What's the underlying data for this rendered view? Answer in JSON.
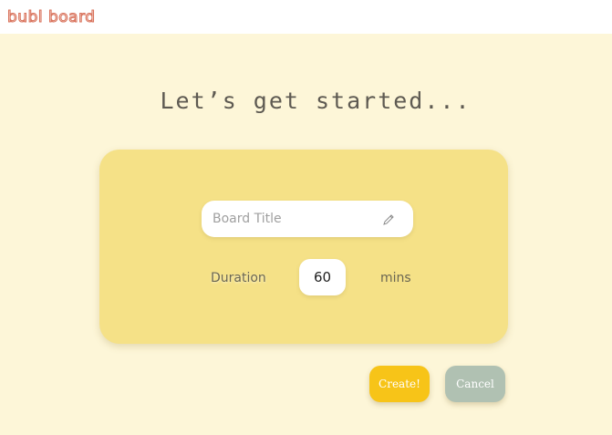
{
  "app": {
    "logo_text": "bubl board"
  },
  "page": {
    "heading": "Let’s get started..."
  },
  "form": {
    "title_placeholder": "Board Title",
    "title_value": "",
    "duration_label": "Duration",
    "duration_value": "60",
    "duration_unit": "mins"
  },
  "actions": {
    "create_label": "Create!",
    "cancel_label": "Cancel"
  },
  "colors": {
    "background": "#fdf6d8",
    "card": "#f5e187",
    "create_button": "#f7c418",
    "cancel_button": "#b0c1b2",
    "logo": "#d9735c"
  },
  "icons": {
    "title_field_icon": "pencil-icon"
  }
}
